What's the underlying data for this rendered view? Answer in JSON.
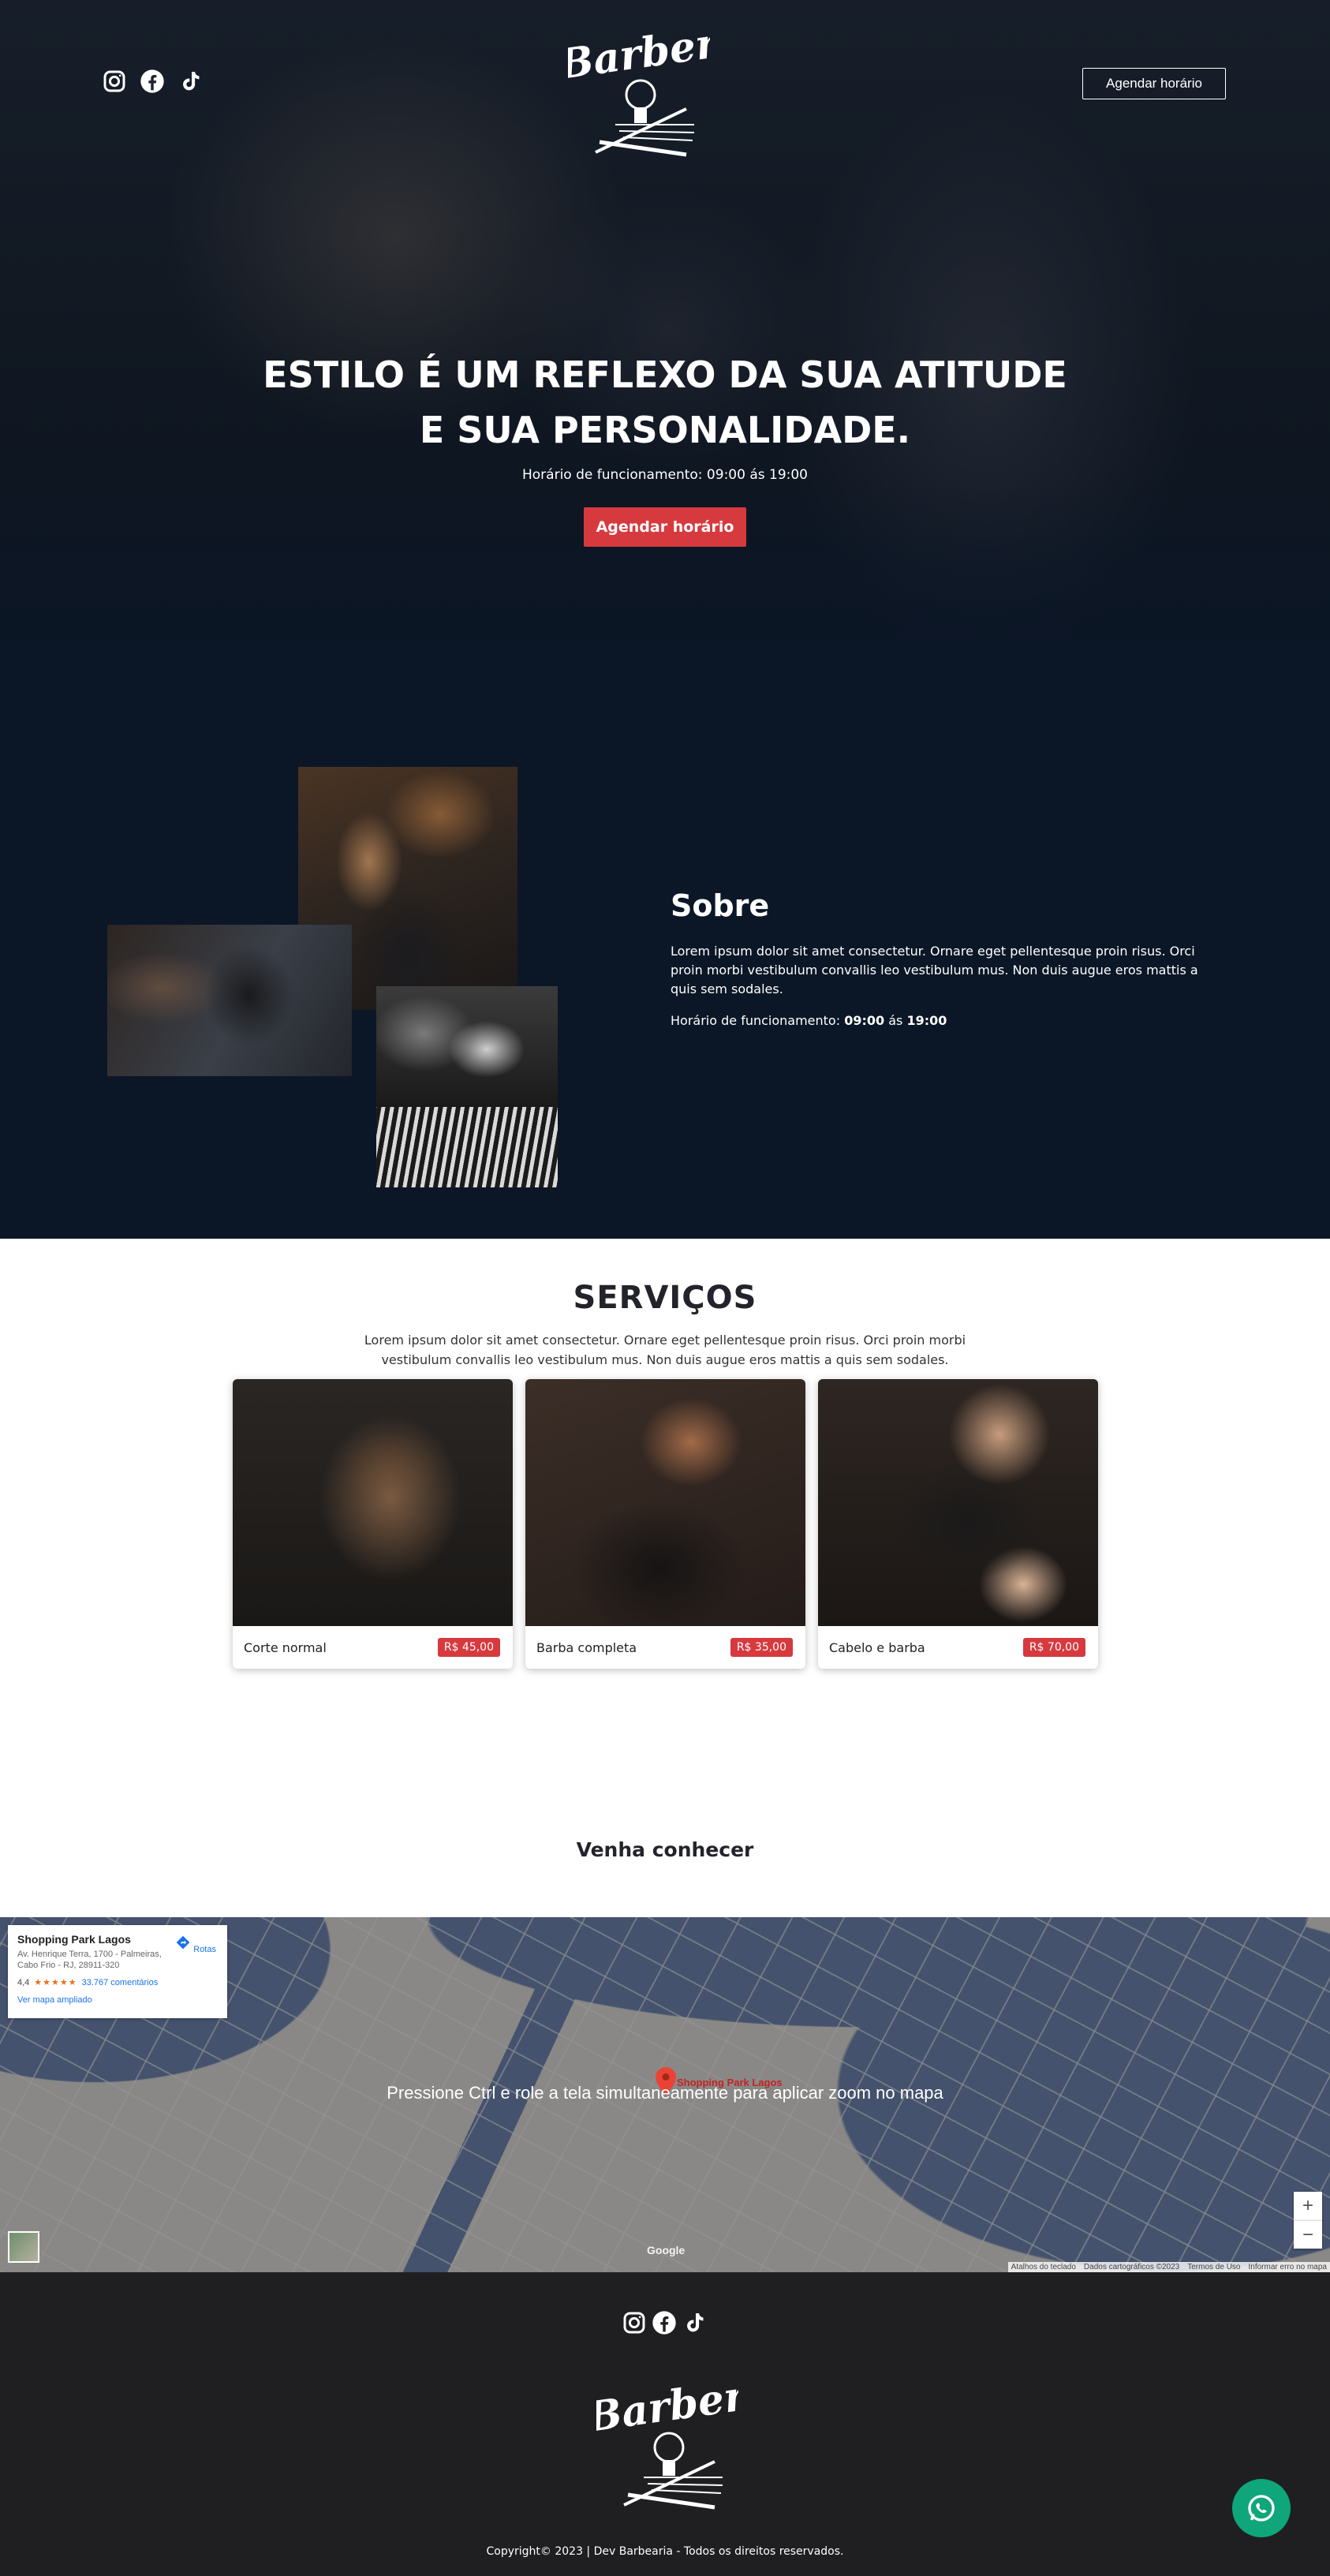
{
  "hero": {
    "logo_text": "Barber",
    "top_cta_label": "Agendar horário",
    "headline_line1": "ESTILO É UM REFLEXO DA SUA ATITUDE",
    "headline_line2": "E SUA PERSONALIDADE.",
    "hours_text": "Horário de funcionamento: 09:00 ás 19:00",
    "cta_label": "Agendar horário",
    "social_icons": [
      "instagram-icon",
      "facebook-icon",
      "tiktok-icon"
    ]
  },
  "sobre": {
    "title": "Sobre",
    "text": "Lorem ipsum dolor sit amet consectetur. Ornare eget pellentesque proin risus. Orci proin morbi vestibulum convallis leo vestibulum mus. Non duis augue eros mattis a quis sem sodales.",
    "hours_label": "Horário de funcionamento: ",
    "hours_open": "09:00",
    "hours_sep": " ás ",
    "hours_close": "19:00"
  },
  "servicos": {
    "title": "SERVIÇOS",
    "description": "Lorem ipsum dolor sit amet consectetur. Ornare eget pellentesque proin risus. Orci proin morbi vestibulum convallis leo vestibulum mus. Non duis augue eros mattis a quis sem sodales.",
    "cards": [
      {
        "name": "Corte normal",
        "price": "R$ 45,00"
      },
      {
        "name": "Barba completa",
        "price": "R$ 35,00"
      },
      {
        "name": "Cabelo e barba",
        "price": "R$ 70,00"
      }
    ]
  },
  "conhecer": {
    "title": "Venha conhecer"
  },
  "map": {
    "overlay_text": "Pressione Ctrl e role a tela simultaneamente para aplicar zoom no mapa",
    "place_name": "Shopping Park Lagos",
    "address": "Av. Henrique Terra, 1700 - Palmeiras, Cabo Frio - RJ, 28911-320",
    "rating": "4,4",
    "stars": "★★★★★",
    "reviews": "33.767 comentários",
    "directions_label": "Rotas",
    "larger_map_link": "Ver mapa ampliado",
    "pin_label": "Shopping Park Lagos",
    "google_mark": "Google",
    "zoom_in": "+",
    "zoom_out": "−",
    "attribution": [
      "Atalhos do teclado",
      "Dados cartográficos ©2023",
      "Termos de Uso",
      "Informar erro no mapa"
    ]
  },
  "footer": {
    "logo_text": "Barber",
    "copyright": "Copyright© 2023 | Dev Barbearia - Todos os direitos reservados.",
    "whatsapp_icon": "whatsapp-icon"
  },
  "colors": {
    "accent": "#d63a3f",
    "navy": "#0b1727",
    "footer": "#1f1f22",
    "whatsapp": "#0ea67a"
  }
}
